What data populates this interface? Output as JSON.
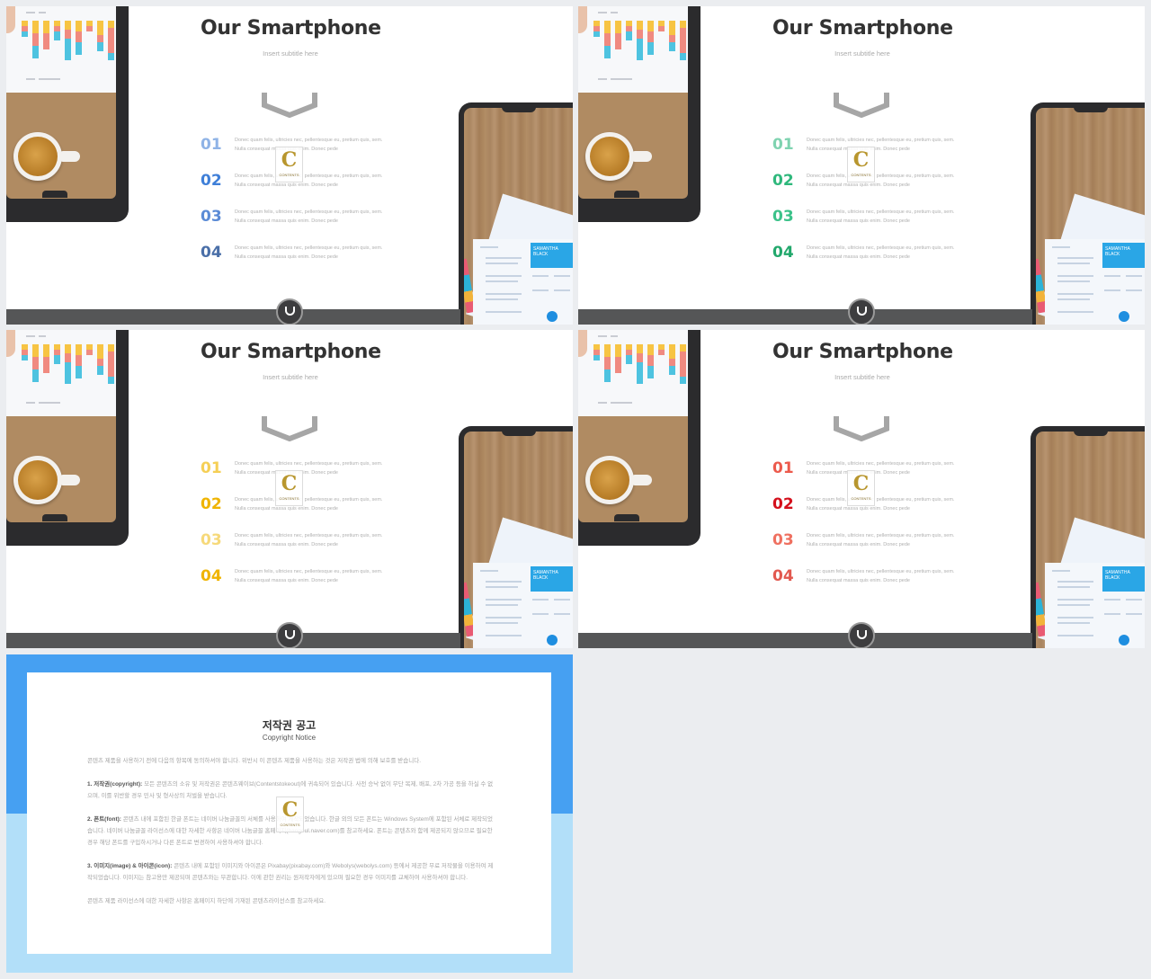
{
  "slides": [
    {
      "title": "Our Smartphone",
      "subtitle": "Insert subtitle here",
      "accent_colors": [
        "#8fb3e6",
        "#3f7fd8",
        "#5b8bd6",
        "#4a6fa8"
      ],
      "items": [
        {
          "number": "01",
          "text": "Donec quam felis, ultricies nec, pellentesque eu, pretium quis, sem. Nulla consequat massa quis enim. Donec pede"
        },
        {
          "number": "02",
          "text": "Donec quam felis, ultricies nec, pellentesque eu, pretium quis, sem. Nulla consequat massa quis enim. Donec pede"
        },
        {
          "number": "03",
          "text": "Donec quam felis, ultricies nec, pellentesque eu, pretium quis, sem. Nulla consequat massa quis enim. Donec pede"
        },
        {
          "number": "04",
          "text": "Donec quam felis, ultricies nec, pellentesque eu, pretium quis, sem. Nulla consequat massa quis enim. Donec pede"
        }
      ]
    },
    {
      "title": "Our Smartphone",
      "subtitle": "Insert subtitle here",
      "accent_colors": [
        "#7fd3b0",
        "#2fb87c",
        "#3cc28a",
        "#22a86c"
      ],
      "items": [
        {
          "number": "01",
          "text": "Donec quam felis, ultricies nec, pellentesque eu, pretium quis, sem. Nulla consequat massa quis enim. Donec pede"
        },
        {
          "number": "02",
          "text": "Donec quam felis, ultricies nec, pellentesque eu, pretium quis, sem. Nulla consequat massa quis enim. Donec pede"
        },
        {
          "number": "03",
          "text": "Donec quam felis, ultricies nec, pellentesque eu, pretium quis, sem. Nulla consequat massa quis enim. Donec pede"
        },
        {
          "number": "04",
          "text": "Donec quam felis, ultricies nec, pellentesque eu, pretium quis, sem. Nulla consequat massa quis enim. Donec pede"
        }
      ]
    },
    {
      "title": "Our Smartphone",
      "subtitle": "Insert subtitle here",
      "accent_colors": [
        "#f5cf55",
        "#efb400",
        "#f6d97a",
        "#f0b400"
      ],
      "items": [
        {
          "number": "01",
          "text": "Donec quam felis, ultricies nec, pellentesque eu, pretium quis, sem. Nulla consequat massa quis enim. Donec pede"
        },
        {
          "number": "02",
          "text": "Donec quam felis, ultricies nec, pellentesque eu, pretium quis, sem. Nulla consequat massa quis enim. Donec pede"
        },
        {
          "number": "03",
          "text": "Donec quam felis, ultricies nec, pellentesque eu, pretium quis, sem. Nulla consequat massa quis enim. Donec pede"
        },
        {
          "number": "04",
          "text": "Donec quam felis, ultricies nec, pellentesque eu, pretium quis, sem. Nulla consequat massa quis enim. Donec pede"
        }
      ]
    },
    {
      "title": "Our Smartphone",
      "subtitle": "Insert subtitle here",
      "accent_colors": [
        "#ec5a4c",
        "#d4101c",
        "#ef7060",
        "#e2584f"
      ],
      "items": [
        {
          "number": "01",
          "text": "Donec quam felis, ultricies nec, pellentesque eu, pretium quis, sem. Nulla consequat massa quis enim. Donec pede"
        },
        {
          "number": "02",
          "text": "Donec quam felis, ultricies nec, pellentesque eu, pretium quis, sem. Nulla consequat massa quis enim. Donec pede"
        },
        {
          "number": "03",
          "text": "Donec quam felis, ultricies nec, pellentesque eu, pretium quis, sem. Nulla consequat massa quis enim. Donec pede"
        },
        {
          "number": "04",
          "text": "Donec quam felis, ultricies nec, pellentesque eu, pretium quis, sem. Nulla consequat massa quis enim. Donec pede"
        }
      ]
    }
  ],
  "resume": {
    "name_line1": "SAMANTHA",
    "name_line2": "BLACK"
  },
  "watermark": {
    "letter": "C",
    "text": "CONTENTS"
  },
  "notice": {
    "title": "저작권 공고",
    "subtitle": "Copyright Notice",
    "intro": "콘텐츠 제품을 사용하기 전에 다음의 항목에 동의하셔야 합니다. 위반시 이 콘텐츠 제품을 사용하는 것은 저작권 법에 의해 보호를 받습니다.",
    "sections": [
      {
        "label": "1. 저작권(copyright):",
        "text": "모든 콘텐츠의 소유 및 저작권은 콘텐츠웨이브(Contentstokeout)에 귀속되어 있습니다. 사전 승낙 없이 무단 복제, 배포, 2차 가공 등을 하실 수 없으며, 이를 위반할 경우 민사 및 형사상의 처벌을 받습니다."
      },
      {
        "label": "2. 폰트(font):",
        "text": "콘텐츠 내에 포함된 한글 폰트는 네이버 나눔글꼴의 서체를 사용하여 제작되었습니다. 한글 외의 모든 폰트는 Windows System에 포함된 서체로 제작되었습니다. 네이버 나눔글꼴 라이선스에 대한 자세한 사항은 네이버 나눔글꼴 홈페이지(hangeul.naver.com)를 참고하세요. 폰트는 콘텐츠와 함께 제공되지 않으므로 필요한 경우 해당 폰트를 구입하시거나 다른 폰트로 변경하여 사용하셔야 합니다."
      },
      {
        "label": "3. 이미지(image) & 아이콘(icon):",
        "text": "콘텐츠 내에 포함된 이미지와 아이콘은 Pixabay(pixabay.com)와 Webolys(webolys.com) 등에서 제공한 무료 저작물을 이용하여 제작되었습니다. 이미지는 참고용만 제공되며 콘텐츠와는 무관합니다. 이에 관한 권리는 원저작자에게 있으며 필요한 경우 이미지를 교체하여 사용하셔야 합니다."
      }
    ],
    "footer": "콘텐츠 제품 라이선스에 대한 자세한 사항은 홈페이지 하단에 기재된 콘텐츠라이선스를 참고하세요."
  }
}
